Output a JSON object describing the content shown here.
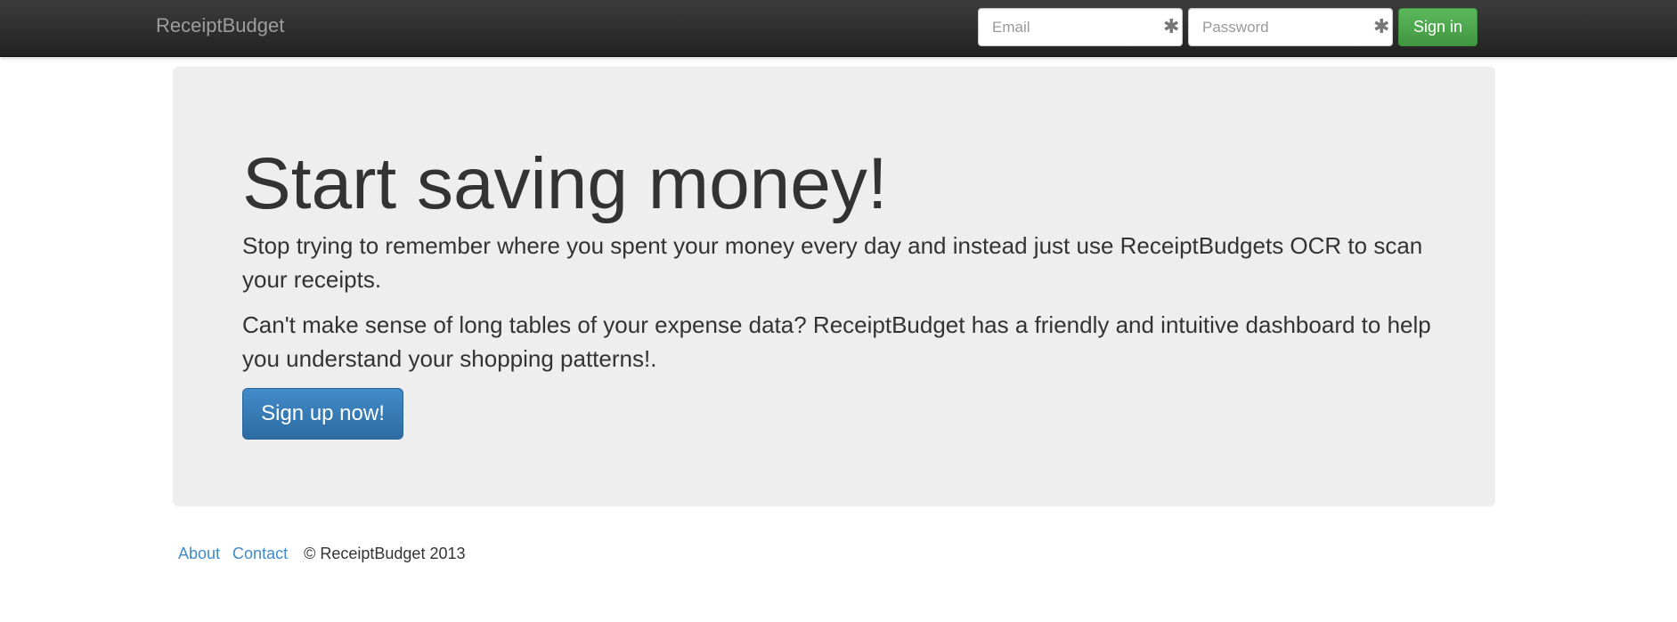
{
  "navbar": {
    "brand": "ReceiptBudget",
    "email_placeholder": "Email",
    "password_placeholder": "Password",
    "required_icon": "asterisk-icon",
    "required_glyph": "✱",
    "signin_label": "Sign in"
  },
  "hero": {
    "title": "Start saving money!",
    "paragraph_1": "Stop trying to remember where you spent your money every day and instead just use ReceiptBudgets OCR to scan your receipts.",
    "paragraph_2": "Can't make sense of long tables of your expense data? ReceiptBudget has a friendly and intuitive dashboard to help you understand your shopping patterns!.",
    "signup_label": "Sign up now!"
  },
  "footer": {
    "links": [
      "About",
      "Contact"
    ],
    "copyright": "© ReceiptBudget 2013"
  },
  "colors": {
    "navbar_bg": "#222222",
    "brand_text": "#9d9d9d",
    "signin_green": "#5cb85c",
    "signup_blue": "#428bca",
    "jumbotron_bg": "#eeeeee",
    "link_blue": "#428bca"
  }
}
